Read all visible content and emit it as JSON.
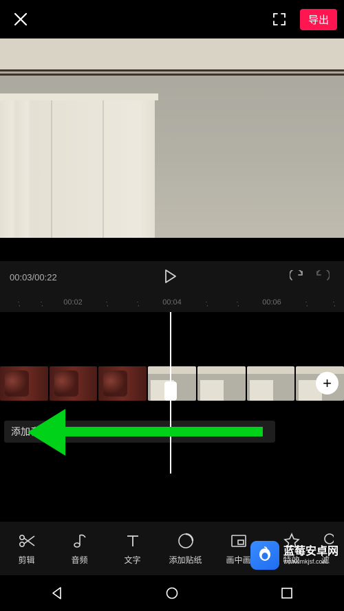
{
  "topbar": {
    "close_icon": "close-icon",
    "expand_icon": "expand-icon",
    "export_label": "导出"
  },
  "playback": {
    "current_time": "00:03",
    "total_time": "00:22",
    "time_display": "00:03/00:22"
  },
  "ruler": {
    "ticks": [
      "00:02",
      "00:04",
      "00:06"
    ]
  },
  "audio_track": {
    "add_audio_label": "添加音频"
  },
  "add_clip": {
    "plus": "+"
  },
  "toolbar": {
    "items": [
      {
        "id": "edit",
        "label": "剪辑"
      },
      {
        "id": "audio",
        "label": "音频"
      },
      {
        "id": "text",
        "label": "文字"
      },
      {
        "id": "sticker",
        "label": "添加贴纸"
      },
      {
        "id": "pip",
        "label": "画中画"
      },
      {
        "id": "fx",
        "label": "特效"
      },
      {
        "id": "filter",
        "label": "滤"
      }
    ]
  },
  "watermark": {
    "title": "蓝莓安卓网",
    "url": "www.lmkjsf.com"
  }
}
